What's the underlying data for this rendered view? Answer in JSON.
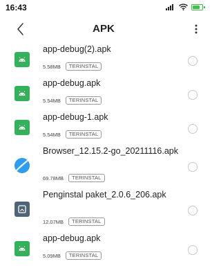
{
  "status_bar": {
    "time": "16:43",
    "icons": [
      "signal-icon",
      "wifi-icon",
      "battery-icon"
    ],
    "battery_level": 0.85,
    "accent": "#3ec34a"
  },
  "header": {
    "title": "APK",
    "back_icon": "chevron-left-icon",
    "more_icon": "more-vertical-icon"
  },
  "files": [
    {
      "name": "app-debug(2).apk",
      "size": "5.58MB",
      "badge": "TERINSTAL",
      "icon": "android-apk-icon"
    },
    {
      "name": "app-debug.apk",
      "size": "5.54MB",
      "badge": "TERINSTAL",
      "icon": "android-apk-icon"
    },
    {
      "name": "app-debug-1.apk",
      "size": "5.54MB",
      "badge": "TERINSTAL",
      "icon": "android-apk-icon"
    },
    {
      "name": "Browser_12.15.2-go_20211116.apk",
      "size": "69.78MB",
      "badge": "TERINSTAL",
      "icon": "browser-icon"
    },
    {
      "name": "Penginstal paket_2.0.6_206.apk",
      "size": "12.07MB",
      "badge": "TERINSTAL",
      "icon": "package-installer-icon"
    },
    {
      "name": "app-debug.apk",
      "size": "5.09MB",
      "badge": "TERINSTAL",
      "icon": "android-apk-icon"
    }
  ],
  "colors": {
    "apk_icon": "#34b15a",
    "browser_icon": "#2f9cf0",
    "installer_icon": "#4f6477"
  }
}
